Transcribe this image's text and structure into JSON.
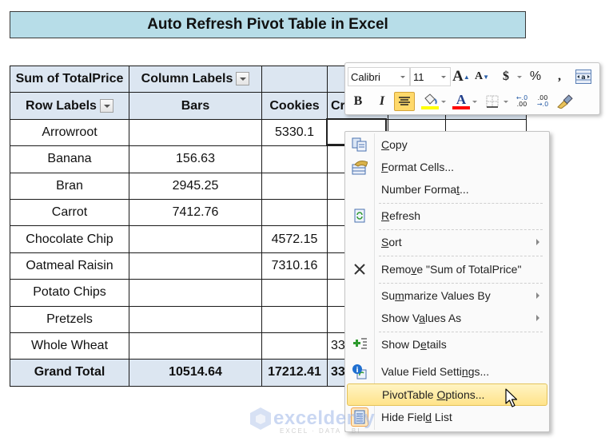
{
  "title": "Auto Refresh Pivot Table in Excel",
  "pivot": {
    "value_field": "Sum of TotalPrice",
    "column_labels": "Column Labels",
    "row_labels": "Row Labels",
    "columns": [
      "Bars",
      "Cookies",
      "Cr"
    ],
    "rows": [
      {
        "label": "Arrowroot",
        "bars": "",
        "cookies": "5330.1",
        "crackers": ""
      },
      {
        "label": "Banana",
        "bars": "156.63",
        "cookies": "",
        "crackers": ""
      },
      {
        "label": "Bran",
        "bars": "2945.25",
        "cookies": "",
        "crackers": ""
      },
      {
        "label": "Carrot",
        "bars": "7412.76",
        "cookies": "",
        "crackers": ""
      },
      {
        "label": "Chocolate Chip",
        "bars": "",
        "cookies": "4572.15",
        "crackers": ""
      },
      {
        "label": "Oatmeal Raisin",
        "bars": "",
        "cookies": "7310.16",
        "crackers": ""
      },
      {
        "label": "Potato Chips",
        "bars": "",
        "cookies": "",
        "crackers": ""
      },
      {
        "label": "Pretzels",
        "bars": "",
        "cookies": "",
        "crackers": ""
      },
      {
        "label": "Whole Wheat",
        "bars": "",
        "cookies": "",
        "crackers": "33"
      }
    ],
    "grand_total": {
      "label": "Grand Total",
      "bars": "10514.64",
      "cookies": "17212.41",
      "crackers": "33"
    }
  },
  "mini_toolbar": {
    "font_name": "Calibri",
    "font_size": "11",
    "grow_font": "A",
    "shrink_font": "A",
    "currency": "$",
    "percent": "%",
    "comma": ",",
    "bold": "B",
    "italic": "I",
    "font_color_letter": "A",
    "fill_color": "#ffff00",
    "font_color": "#ff0000",
    "increase_decimal": "←.0 .00",
    "decrease_decimal": ".00 →.0"
  },
  "context_menu": {
    "items": [
      {
        "pre": "",
        "u": "C",
        "post": "opy",
        "icon": "copy-icon"
      },
      {
        "pre": "",
        "u": "F",
        "post": "ormat Cells...",
        "icon": "format-cells-icon"
      },
      {
        "pre": "Number Forma",
        "u": "t",
        "post": "...",
        "icon": ""
      },
      {
        "pre": "",
        "u": "R",
        "post": "efresh",
        "icon": "refresh-icon"
      },
      {
        "pre": "",
        "u": "S",
        "post": "ort",
        "icon": "",
        "submenu": true
      },
      {
        "pre": "Remo",
        "u": "v",
        "post": "e \"Sum of TotalPrice\"",
        "icon": "remove-icon"
      },
      {
        "pre": "Su",
        "u": "m",
        "post": "marize Values By",
        "icon": "",
        "submenu": true
      },
      {
        "pre": "Show V",
        "u": "a",
        "post": "lues As",
        "icon": "",
        "submenu": true
      },
      {
        "pre": "Show D",
        "u": "e",
        "post": "tails",
        "icon": "show-details-icon"
      },
      {
        "pre": "Value Field Setti",
        "u": "n",
        "post": "gs...",
        "icon": "value-field-settings-icon"
      },
      {
        "pre": "PivotTable ",
        "u": "O",
        "post": "ptions...",
        "icon": "",
        "highlighted": true
      },
      {
        "pre": "Hide Fiel",
        "u": "d",
        "post": " List",
        "icon": "field-list-icon"
      }
    ]
  },
  "watermark": {
    "name": "exceldemy",
    "tagline": "EXCEL · DATA · BI"
  },
  "colors": {
    "title_bg": "#b7dde8",
    "header_bg": "#dce6f1",
    "menu_highlight": "#ffe38a"
  }
}
